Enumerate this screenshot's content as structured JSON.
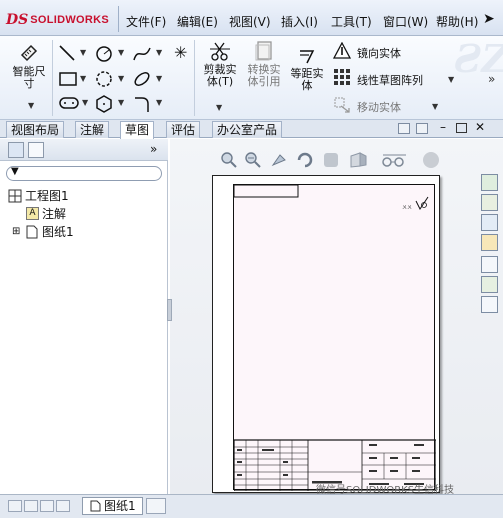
{
  "app": {
    "logo_ds": "DS",
    "logo_text": "SOLIDWORKS"
  },
  "menu": {
    "items": [
      "文件(F)",
      "编辑(E)",
      "视图(V)",
      "插入(I)",
      "工具(T)",
      "窗口(W)",
      "帮助(H)"
    ]
  },
  "ribbon": {
    "smart_dim": "智能尺\n寸",
    "trim": "剪裁实\n体(T)",
    "convert": "转换实\n体引用",
    "offset": "等距实\n体",
    "mirror": "镜向实体",
    "pattern": "线性草图阵列",
    "move": "移动实体"
  },
  "tabs": [
    "视图布局",
    "注解",
    "草图",
    "评估",
    "办公室产品"
  ],
  "active_tab": "草图",
  "tree": {
    "root": "工程图1",
    "annotations": "注解",
    "sheet": "图纸1"
  },
  "bottom": {
    "sheet_tab": "图纸1"
  },
  "watermark": "微信号SOLIDWORKS生信科技"
}
